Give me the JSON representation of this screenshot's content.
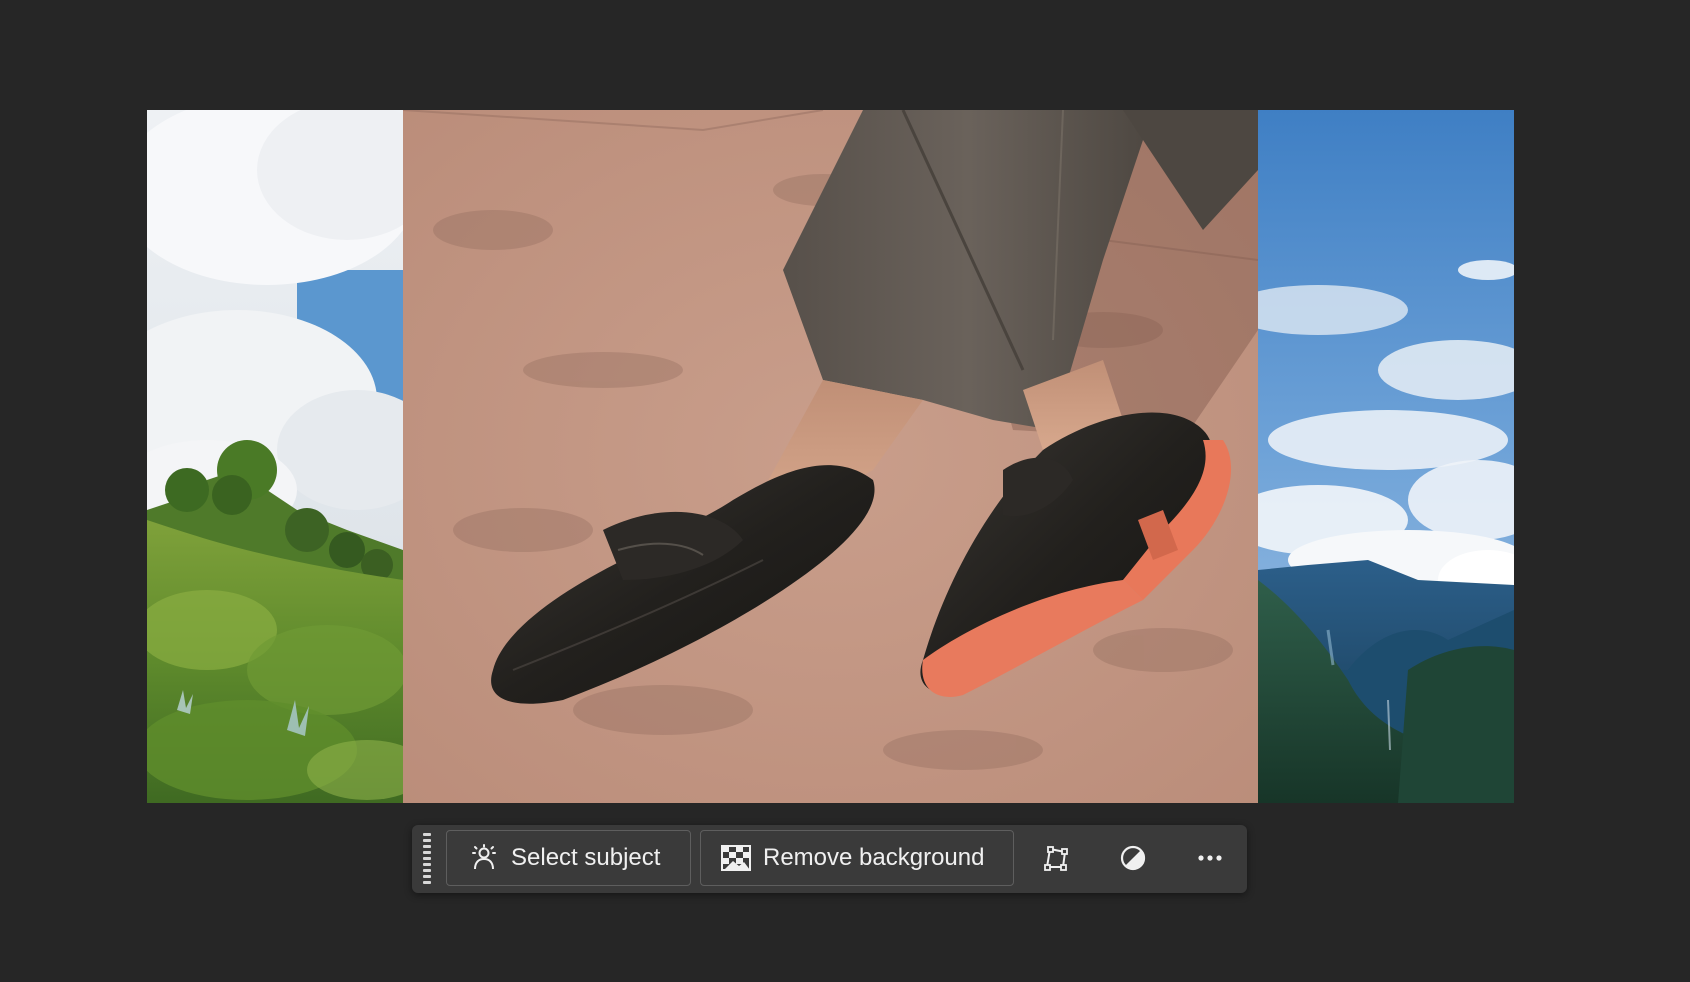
{
  "toolbar": {
    "select_subject_label": "Select subject",
    "remove_background_label": "Remove background",
    "icons": {
      "grip": "drag-handle-icon",
      "select_subject": "person-selection-icon",
      "remove_background": "checkerboard-icon",
      "transform": "transform-shape-icon",
      "adjust": "half-circle-adjust-icon",
      "more": "more-options-icon"
    }
  },
  "colors": {
    "workspace_bg": "#262626",
    "toolbar_bg": "#3a3a3a",
    "toolbar_border": "#5e5e5e",
    "toolbar_text": "#f0f0f0",
    "shoe_sole": "#e87a5d"
  }
}
